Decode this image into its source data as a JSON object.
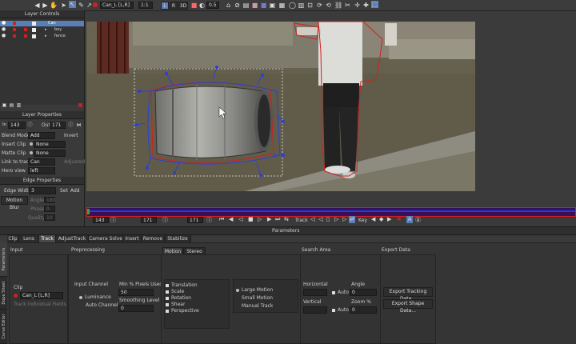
{
  "toolbar": {
    "clip_name": "Can_L [L,R]",
    "zoom": "1:1",
    "left_label": "L",
    "right_label": "R",
    "three_d_label": "3D",
    "opacity_value": "0.5"
  },
  "layer_controls": {
    "title": "Layer Controls",
    "layers": [
      {
        "name": "Can"
      },
      {
        "name": "boy"
      },
      {
        "name": "fence"
      }
    ]
  },
  "layer_properties": {
    "title": "Layer Properties",
    "in_value": "143",
    "out_label": "Out",
    "out_value": "171",
    "blend_mode_label": "Blend Mode",
    "blend_mode_value": "Add",
    "invert_label": "Invert",
    "insert_clip_label": "Insert Clip",
    "insert_clip_value": "None",
    "matte_clip_label": "Matte Clip",
    "matte_clip_value": "None",
    "link_to_track_label": "Link to track",
    "link_to_track_value": "Can",
    "adjusted_label": "Adjusted",
    "hero_view_label": "Hero view",
    "hero_view_value": "left"
  },
  "edge_properties": {
    "title": "Edge Properties",
    "edge_width_label": "Edge Width",
    "edge_width_value": "3",
    "set_label": "Set",
    "add_label": "Add",
    "motion_blur_label": "Motion Blur",
    "angle_label": "Angle",
    "angle_value": "180",
    "phase_label": "Phase",
    "phase_value": "0",
    "quality_label": "Quality",
    "quality_value": "10"
  },
  "timeline": {
    "in_frame": "143",
    "current_frame": "171",
    "out_frame": "171",
    "track_label": "Track",
    "key_label": "Key"
  },
  "parameters": {
    "title": "Parameters",
    "tabs": [
      "Clip",
      "Lens",
      "Track",
      "AdjustTrack",
      "Camera Solve",
      "Insert",
      "Remove",
      "Stabilize"
    ],
    "active_tab": "Track",
    "side_tabs": [
      "Parameters",
      "Dope Sheet",
      "Curve Editor"
    ],
    "input": {
      "title": "Input",
      "clip_label": "Clip",
      "clip_value": "Can_L [L,R]",
      "track_individual_fields": "Track Individual Fields"
    },
    "preprocessing": {
      "title": "Preprocessing",
      "input_channel_label": "Input Channel",
      "luminance_label": "Luminance",
      "auto_channel_label": "Auto Channel",
      "min_pixels_label": "Min % Pixels Used",
      "min_pixels_value": "50",
      "smoothing_label": "Smoothing Level",
      "smoothing_value": "0"
    },
    "motion": {
      "tab_motion": "Motion",
      "tab_stereo": "Stereo",
      "options": [
        "Translation",
        "Scale",
        "Rotation",
        "Shear",
        "Perspective"
      ],
      "model_options": [
        "Large Motion",
        "Small Motion",
        "Manual Track"
      ]
    },
    "search_area": {
      "title": "Search Area",
      "horizontal_label": "Horizontal",
      "vertical_label": "Vertical",
      "auto_label_h": "Auto",
      "auto_label_v": "Auto",
      "angle_label": "Angle",
      "angle_value": "0",
      "zoom_label": "Zoom %",
      "zoom_value": "0"
    },
    "export_data": {
      "title": "Export Data",
      "export_tracking": "Export Tracking Data...",
      "export_shape": "Export Shape Data..."
    }
  },
  "colors": {
    "accent_red": "#d02020",
    "track_blue": "#2a3fd8",
    "selection_blue": "#5a7fb8"
  }
}
